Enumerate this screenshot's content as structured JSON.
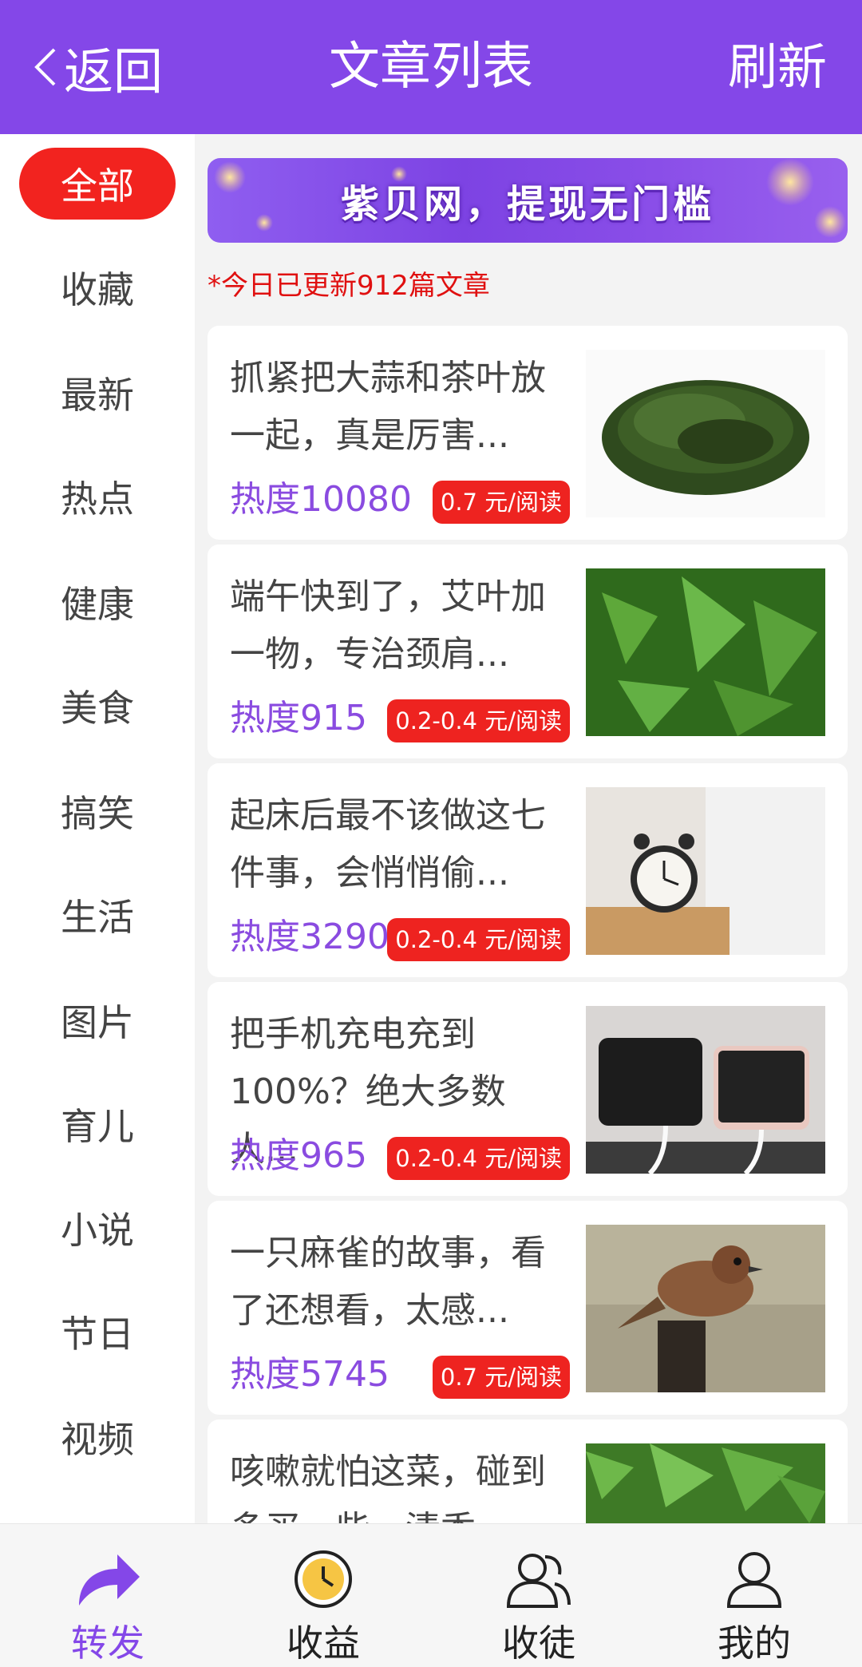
{
  "header": {
    "back_label": "返回",
    "title": "文章列表",
    "refresh_label": "刷新"
  },
  "sidebar": {
    "items": [
      {
        "label": "全部",
        "active": true
      },
      {
        "label": "收藏"
      },
      {
        "label": "最新"
      },
      {
        "label": "热点"
      },
      {
        "label": "健康"
      },
      {
        "label": "美食"
      },
      {
        "label": "搞笑"
      },
      {
        "label": "生活"
      },
      {
        "label": "图片"
      },
      {
        "label": "育儿"
      },
      {
        "label": "小说"
      },
      {
        "label": "节日"
      },
      {
        "label": "视频"
      }
    ]
  },
  "banner": {
    "text": "紫贝网，提现无门槛"
  },
  "notice": "*今日已更新912篇文章",
  "articles": [
    {
      "title": "抓紧把大蒜和茶叶放一起，真是厉害...",
      "heat": "热度10080",
      "price": "0.7 元/阅读",
      "image": "green-tea-leaves"
    },
    {
      "title": "端午快到了，艾叶加一物，专治颈肩...",
      "heat": "热度915",
      "price": "0.2-0.4 元/阅读",
      "image": "mugwort-leaves"
    },
    {
      "title": "起床后最不该做这七件事，会悄悄偷...",
      "heat": "热度3290",
      "price": "0.2-0.4 元/阅读",
      "image": "alarm-clock-bedside"
    },
    {
      "title": "把手机充电充到100%？绝大多数人...",
      "heat": "热度965",
      "price": "0.2-0.4 元/阅读",
      "image": "phones-charging"
    },
    {
      "title": "一只麻雀的故事，看了还想看，太感...",
      "heat": "热度5745",
      "price": "0.7 元/阅读",
      "image": "sparrow-on-post"
    },
    {
      "title": "咳嗽就怕这菜，碰到多买一些，清香...",
      "heat": "",
      "price": "",
      "image": "green-vegetable"
    }
  ],
  "bottom_nav": [
    {
      "label": "转发",
      "icon": "share-arrow-icon",
      "active": true
    },
    {
      "label": "收益",
      "icon": "clock-coin-icon"
    },
    {
      "label": "收徒",
      "icon": "people-icon"
    },
    {
      "label": "我的",
      "icon": "person-icon"
    }
  ],
  "colors": {
    "brand": "#8447e8",
    "accent_red": "#f2231f",
    "heat_purple": "#8a4be0"
  }
}
